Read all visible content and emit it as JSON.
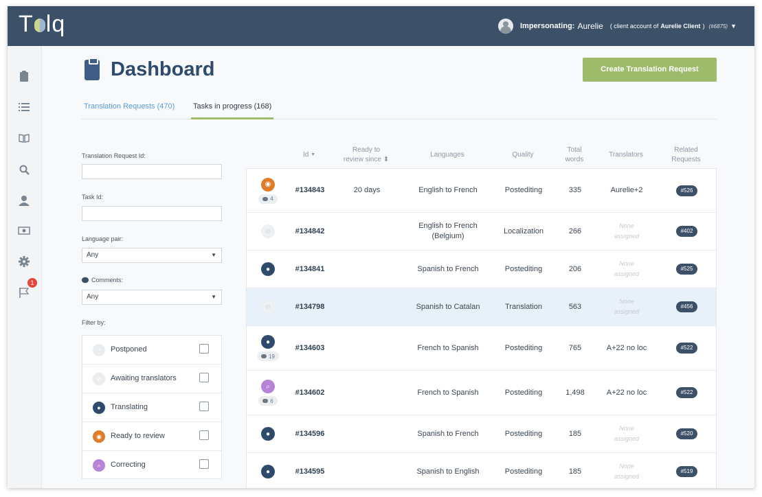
{
  "app": {
    "logo_text_before": "T",
    "logo_text_after": "lq"
  },
  "topbar": {
    "impersonating_label": "Impersonating:",
    "user_name": "Aurelie",
    "account_prefix": "( client account of",
    "account_name": "Aurelie Client",
    "account_suffix": ")",
    "account_number": "(#6875)",
    "caret": "▼"
  },
  "sidebar": {
    "icons": [
      "clipboard-icon",
      "list-icon",
      "book-icon",
      "search-icon",
      "user-icon",
      "money-icon",
      "gear-icon",
      "flag-icon"
    ],
    "flag_badge": "1"
  },
  "page": {
    "title": "Dashboard",
    "create_button": "Create Translation Request",
    "tabs": [
      {
        "label": "Translation Requests (470)",
        "active": false
      },
      {
        "label": "Tasks in progress (168)",
        "active": true
      }
    ]
  },
  "filters": {
    "tr_id_label": "Translation Request Id:",
    "task_id_label": "Task Id:",
    "lang_label": "Language pair:",
    "lang_value": "Any",
    "comments_label": "Comments:",
    "comments_value": "Any",
    "filter_by_label": "Filter by:",
    "statuses": [
      {
        "label": "Postponed",
        "color": "#e9edf0"
      },
      {
        "label": "Awaiting translators",
        "color": "#e9edf0"
      },
      {
        "label": "Translating",
        "color": "#2f4a6b"
      },
      {
        "label": "Ready to review",
        "color": "#e07d2a"
      },
      {
        "label": "Correcting",
        "color": "#b783d6"
      }
    ]
  },
  "table": {
    "headers": {
      "id": "Id",
      "id_sort": "▼",
      "ready_line1": "Ready to",
      "ready_line2": "review since",
      "ready_sort": "⬍",
      "languages": "Languages",
      "quality": "Quality",
      "words_line1": "Total",
      "words_line2": "words",
      "translators": "Translators",
      "related_line1": "Related",
      "related_line2": "Requests"
    },
    "none_line1": "None",
    "none_line2": "assigned",
    "rows": [
      {
        "status": "review",
        "comments": "4",
        "id": "#134843",
        "ready": "20 days",
        "lang1": "English to French",
        "lang2": "",
        "quality": "Postediting",
        "words": "335",
        "translators": "Aurelie+2",
        "related": "#526"
      },
      {
        "status": "awaiting",
        "comments": "",
        "id": "#134842",
        "ready": "",
        "lang1": "English to French",
        "lang2": "(Belgium)",
        "quality": "Localization",
        "words": "266",
        "translators": "",
        "related": "#402"
      },
      {
        "status": "translating",
        "comments": "",
        "id": "#134841",
        "ready": "",
        "lang1": "Spanish to French",
        "lang2": "",
        "quality": "Postediting",
        "words": "206",
        "translators": "",
        "related": "#525"
      },
      {
        "status": "awaiting",
        "comments": "",
        "id": "#134798",
        "ready": "",
        "lang1": "Spanish to Catalan",
        "lang2": "",
        "quality": "Translation",
        "words": "563",
        "translators": "",
        "related": "#456"
      },
      {
        "status": "translating",
        "comments": "19",
        "id": "#134603",
        "ready": "",
        "lang1": "French to Spanish",
        "lang2": "",
        "quality": "Postediting",
        "words": "765",
        "translators": "A+22 no loc",
        "related": "#522"
      },
      {
        "status": "correcting",
        "comments": "6",
        "id": "#134602",
        "ready": "",
        "lang1": "French to Spanish",
        "lang2": "",
        "quality": "Postediting",
        "words": "1,498",
        "translators": "A+22 no loc",
        "related": "#522"
      },
      {
        "status": "translating",
        "comments": "",
        "id": "#134596",
        "ready": "",
        "lang1": "Spanish to French",
        "lang2": "",
        "quality": "Postediting",
        "words": "185",
        "translators": "",
        "related": "#520"
      },
      {
        "status": "translating",
        "comments": "",
        "id": "#134595",
        "ready": "",
        "lang1": "Spanish to English",
        "lang2": "",
        "quality": "Postediting",
        "words": "185",
        "translators": "",
        "related": "#519"
      }
    ]
  }
}
